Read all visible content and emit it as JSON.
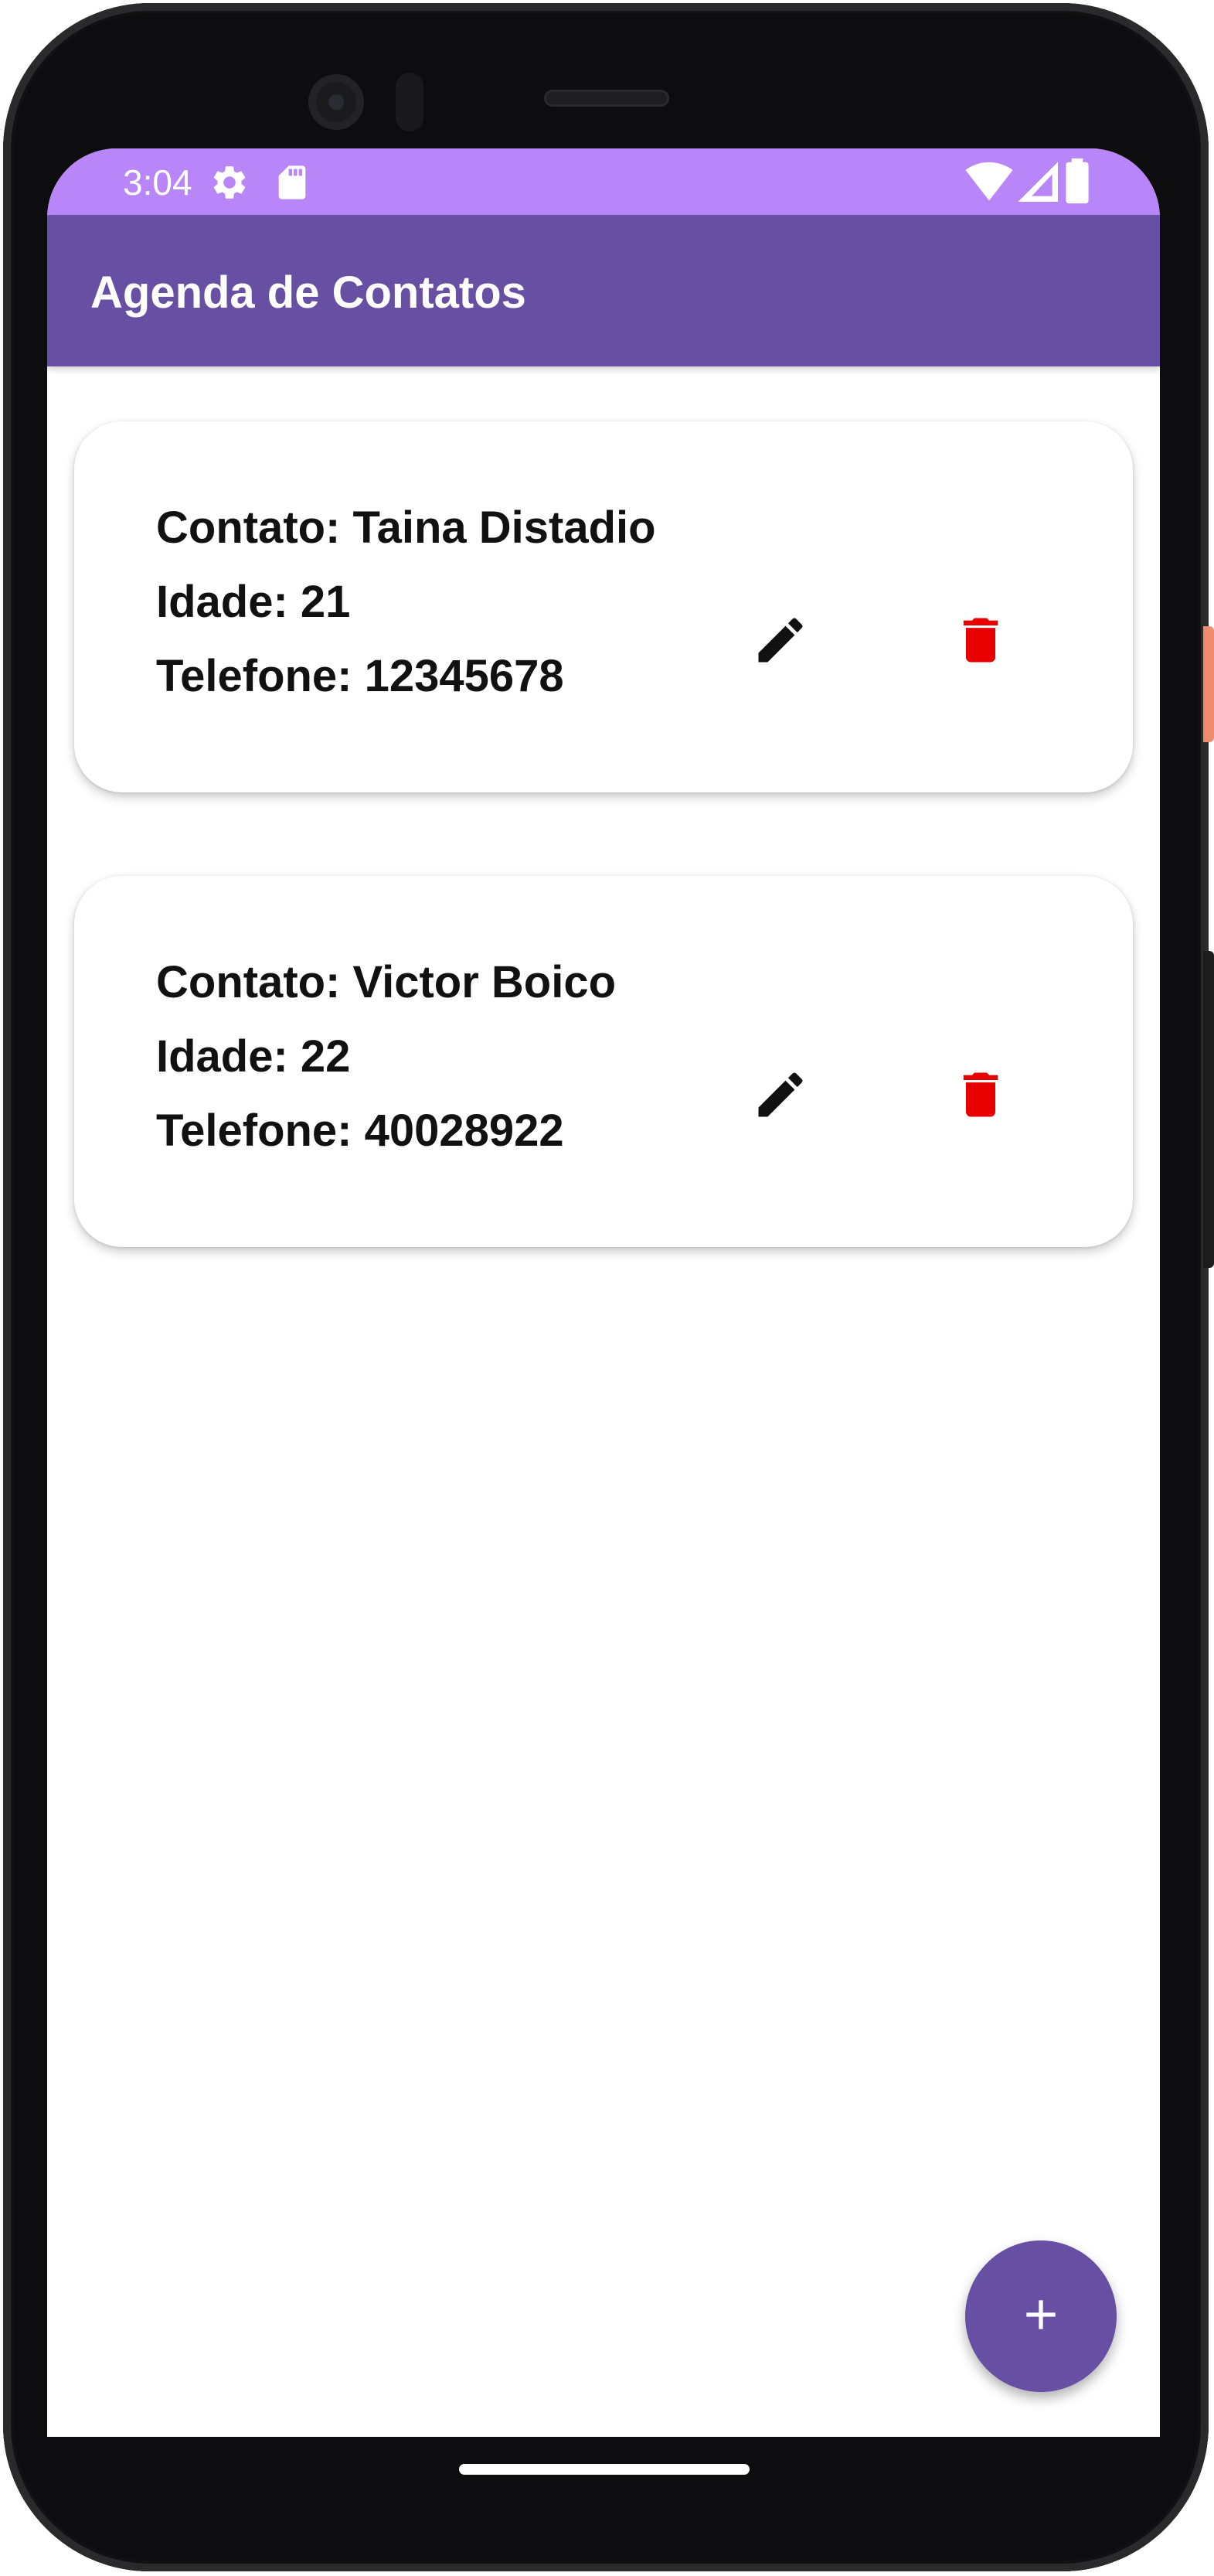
{
  "status_bar": {
    "time": "3:04",
    "icons": [
      "settings-icon",
      "sd-card-icon",
      "wifi-icon",
      "cellular-signal-icon",
      "battery-icon"
    ]
  },
  "app_bar": {
    "title": "Agenda de Contatos"
  },
  "contacts": [
    {
      "contact_line": "Contato: Taina Distadio",
      "age_line": "Idade: 21",
      "phone_line": "Telefone: 12345678"
    },
    {
      "contact_line": "Contato: Victor Boico",
      "age_line": "Idade: 22",
      "phone_line": "Telefone: 40028922"
    }
  ],
  "actions": {
    "edit_icon": "pencil-icon",
    "delete_icon": "trash-icon",
    "add_icon": "plus-icon"
  },
  "colors": {
    "status_bar": "#b886f8",
    "app_bar": "#6750a4",
    "fab": "#6750a4",
    "delete": "#e60000",
    "edit": "#111111"
  }
}
